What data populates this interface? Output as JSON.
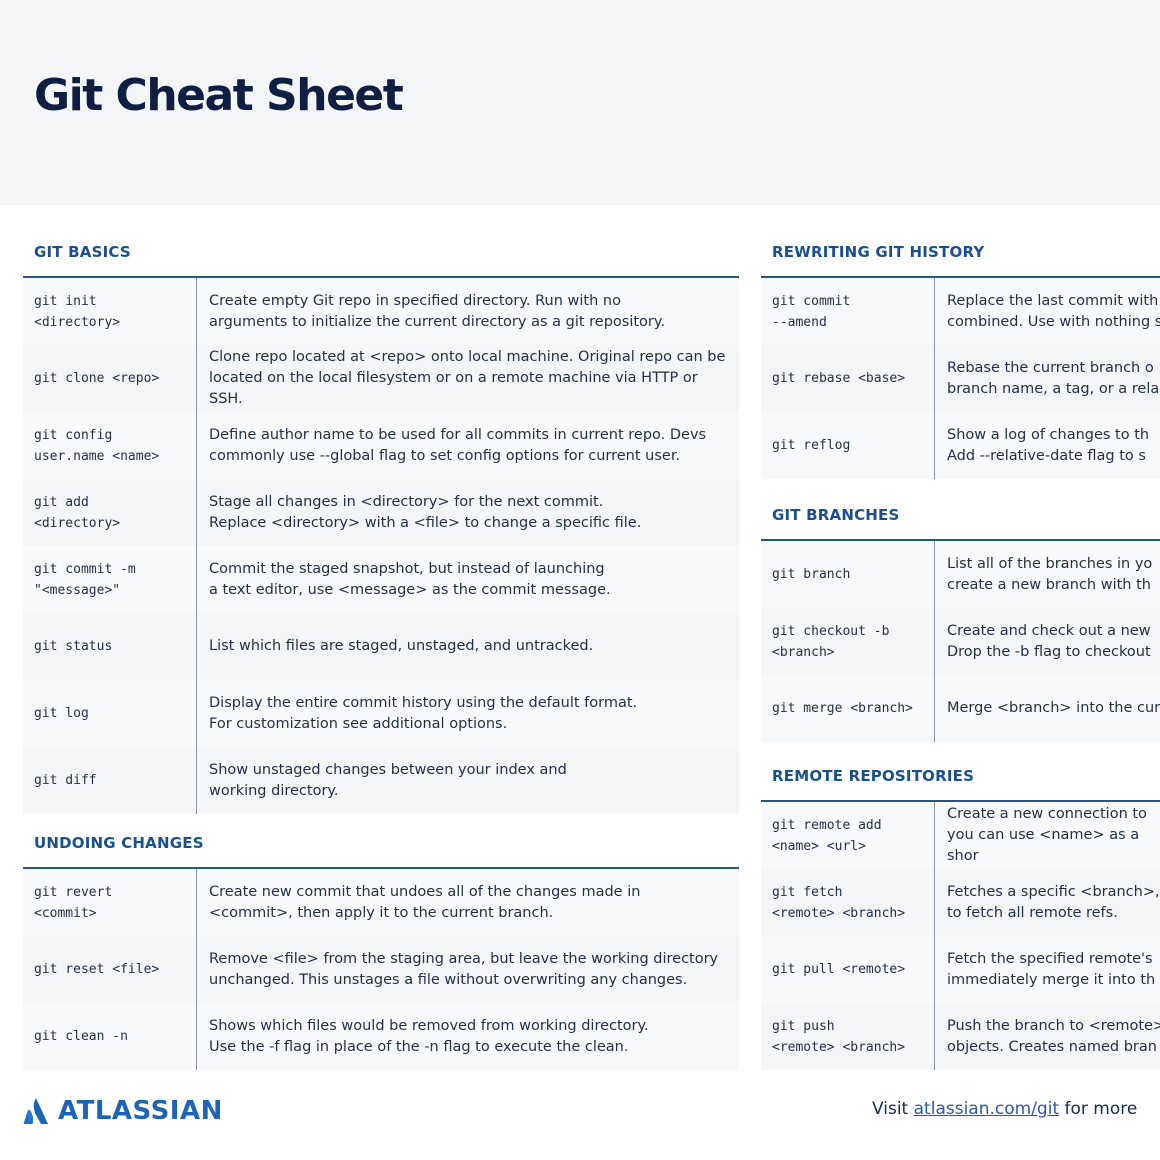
{
  "header": {
    "title": "Git Cheat Sheet"
  },
  "sections": {
    "basics": {
      "title": "GIT BASICS",
      "rows": [
        {
          "cmd": "git init\n<directory>",
          "desc": "Create empty Git repo in specified directory. Run with no\narguments to initialize the current directory as a git repository."
        },
        {
          "cmd": "git clone <repo>",
          "desc": "Clone repo located at <repo> onto local machine. Original repo can be\nlocated on the local filesystem or on a remote machine via HTTP or SSH."
        },
        {
          "cmd": "git config\nuser.name <name>",
          "desc": "Define author name to be used for all commits in current repo. Devs\ncommonly use --global flag to set config options for current user."
        },
        {
          "cmd": "git add\n<directory>",
          "desc": "Stage all changes in <directory> for the next commit.\nReplace <directory> with a <file> to change a specific file."
        },
        {
          "cmd": "git commit -m\n\"<message>\"",
          "desc": "Commit the staged snapshot, but instead of launching\na text editor, use <message> as the commit message."
        },
        {
          "cmd": "git status",
          "desc": "List which files are staged, unstaged, and untracked."
        },
        {
          "cmd": "git log",
          "desc": "Display the entire commit history using the default format.\nFor customization see additional options."
        },
        {
          "cmd": "git diff",
          "desc": "Show unstaged changes between your index and\nworking directory."
        }
      ]
    },
    "undoing": {
      "title": "UNDOING CHANGES",
      "rows": [
        {
          "cmd": "git revert\n<commit>",
          "desc": "Create new commit that undoes all of the changes made in\n<commit>, then apply it to the current branch."
        },
        {
          "cmd": "git reset <file>",
          "desc": "Remove <file> from the staging area, but leave the working directory\nunchanged. This unstages a file without overwriting any changes."
        },
        {
          "cmd": "git clean -n",
          "desc": "Shows which files would be removed from working directory.\nUse the -f flag in place of the -n flag to execute the clean."
        }
      ]
    },
    "rewriting": {
      "title": "REWRITING GIT HISTORY",
      "rows": [
        {
          "cmd": "git commit\n--amend",
          "desc": "Replace the last commit with\ncombined. Use with nothing s"
        },
        {
          "cmd": "git rebase <base>",
          "desc": "Rebase the current branch o\nbranch name, a tag, or a rela"
        },
        {
          "cmd": "git reflog",
          "desc": "Show a log of changes to th\nAdd --relative-date flag to s"
        }
      ]
    },
    "branches": {
      "title": "GIT BRANCHES",
      "rows": [
        {
          "cmd": "git branch",
          "desc": "List all of the branches in yo\ncreate a new branch with th"
        },
        {
          "cmd": "git checkout -b\n<branch>",
          "desc": "Create and check out a new\nDrop the -b flag to checkout"
        },
        {
          "cmd": "git merge <branch>",
          "desc": "Merge <branch> into the curr"
        }
      ]
    },
    "remote": {
      "title": "REMOTE REPOSITORIES",
      "rows": [
        {
          "cmd": "git remote add\n<name> <url>",
          "desc": "Create a new connection to\nyou can use <name> as a shor"
        },
        {
          "cmd": "git fetch\n<remote> <branch>",
          "desc": "Fetches a specific <branch>, f\nto fetch all remote refs."
        },
        {
          "cmd": "git pull <remote>",
          "desc": "Fetch the specified remote's\nimmediately merge it into th"
        },
        {
          "cmd": "git push\n<remote> <branch>",
          "desc": "Push the branch to <remote>,\nobjects. Creates named bran"
        }
      ]
    }
  },
  "footer": {
    "brand": "ATLASSIAN",
    "visit_prefix": "Visit ",
    "link_text": "atlassian.com/git",
    "visit_suffix": " for more"
  },
  "colors": {
    "accent": "#1a4f8f",
    "brand": "#1e64b6",
    "title": "#0f1f42",
    "band": "#f3f5f7"
  }
}
